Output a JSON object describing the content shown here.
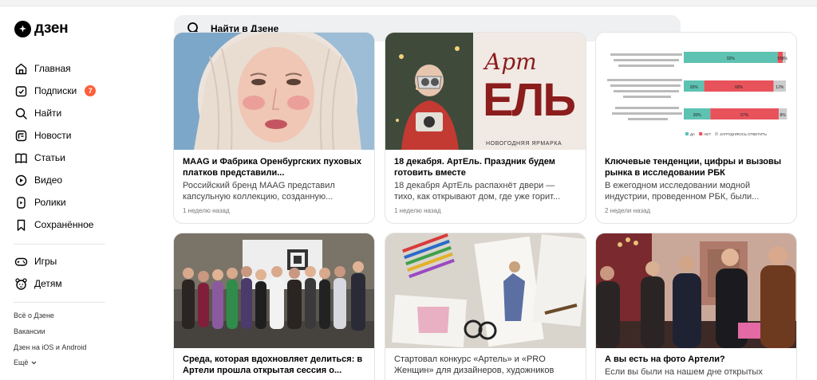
{
  "header": {
    "logo_text": "дзен",
    "search_placeholder": "Найти в Дзене"
  },
  "sidebar": {
    "items": [
      {
        "label": "Главная",
        "icon": "home-icon"
      },
      {
        "label": "Подписки",
        "icon": "subscriptions-icon",
        "badge": "7"
      },
      {
        "label": "Найти",
        "icon": "search-icon"
      },
      {
        "label": "Новости",
        "icon": "news-icon"
      },
      {
        "label": "Статьи",
        "icon": "articles-icon"
      },
      {
        "label": "Видео",
        "icon": "video-icon"
      },
      {
        "label": "Ролики",
        "icon": "shorts-icon"
      },
      {
        "label": "Сохранённое",
        "icon": "bookmark-icon"
      }
    ],
    "items2": [
      {
        "label": "Игры",
        "icon": "gamepad-icon"
      },
      {
        "label": "Детям",
        "icon": "kids-icon"
      }
    ],
    "footer_links": [
      "Всё о Дзене",
      "Вакансии",
      "Дзен на iOS и Android",
      "Ещё"
    ]
  },
  "cards": [
    {
      "title": "MAAG и Фабрика Оренбургских пуховых платков представили...",
      "desc": "Российский бренд MAAG представил капсульную коллекцию, созданную...",
      "time": "1 неделю назад"
    },
    {
      "title": "18 декабря. АртЕль. Праздник будем готовить вместе",
      "desc": "18 декабря АртЕль распахнёт двери — тихо, как открывают дом, где уже горит...",
      "time": "1 неделю назад",
      "poster_word1": "Арт",
      "poster_word2": "ЕЛЬ",
      "poster_caption": "НОВОГОДНЯЯ ЯРМАРКА"
    },
    {
      "title": "Ключевые тенденции, цифры и вызовы рынка в исследовании РБК",
      "desc": "В ежегодном исследовании модной индустрии, проведенном РБК, были...",
      "time": "2 недели назад",
      "chart_legend": [
        "ДА",
        "НЕТ",
        "ЗАТРУДНЯЮСЬ ОТВЕТИТЬ"
      ],
      "chart_rows": [
        {
          "yes": 92,
          "no": 5,
          "na": 3,
          "yes_label": "92%",
          "no_label": "5%",
          "na_label": "3%"
        },
        {
          "yes": 20,
          "no": 68,
          "na": 12,
          "yes_label": "20%",
          "no_label": "68%",
          "na_label": "12%"
        },
        {
          "yes": 26,
          "no": 67,
          "na": 8,
          "yes_label": "26%",
          "no_label": "67%",
          "na_label": "8%"
        }
      ],
      "chart_colors": {
        "yes": "#5ec2b2",
        "no": "#e8535b",
        "na": "#cccccc"
      }
    },
    {
      "title": "Среда, которая вдохновляет делиться: в Артели прошла открытая сессия о...",
      "desc": "",
      "time": ""
    },
    {
      "title": "Стартовал конкурс «Артель» и «PRO Женщин» для дизайнеров, художников",
      "desc": "",
      "time": ""
    },
    {
      "title": "А вы есть на фото Артели?",
      "desc": "Если вы были на нашем дне открытых",
      "time": ""
    }
  ],
  "colors": {
    "badge": "#ff5e3a",
    "search_bg": "#eff0f2"
  }
}
